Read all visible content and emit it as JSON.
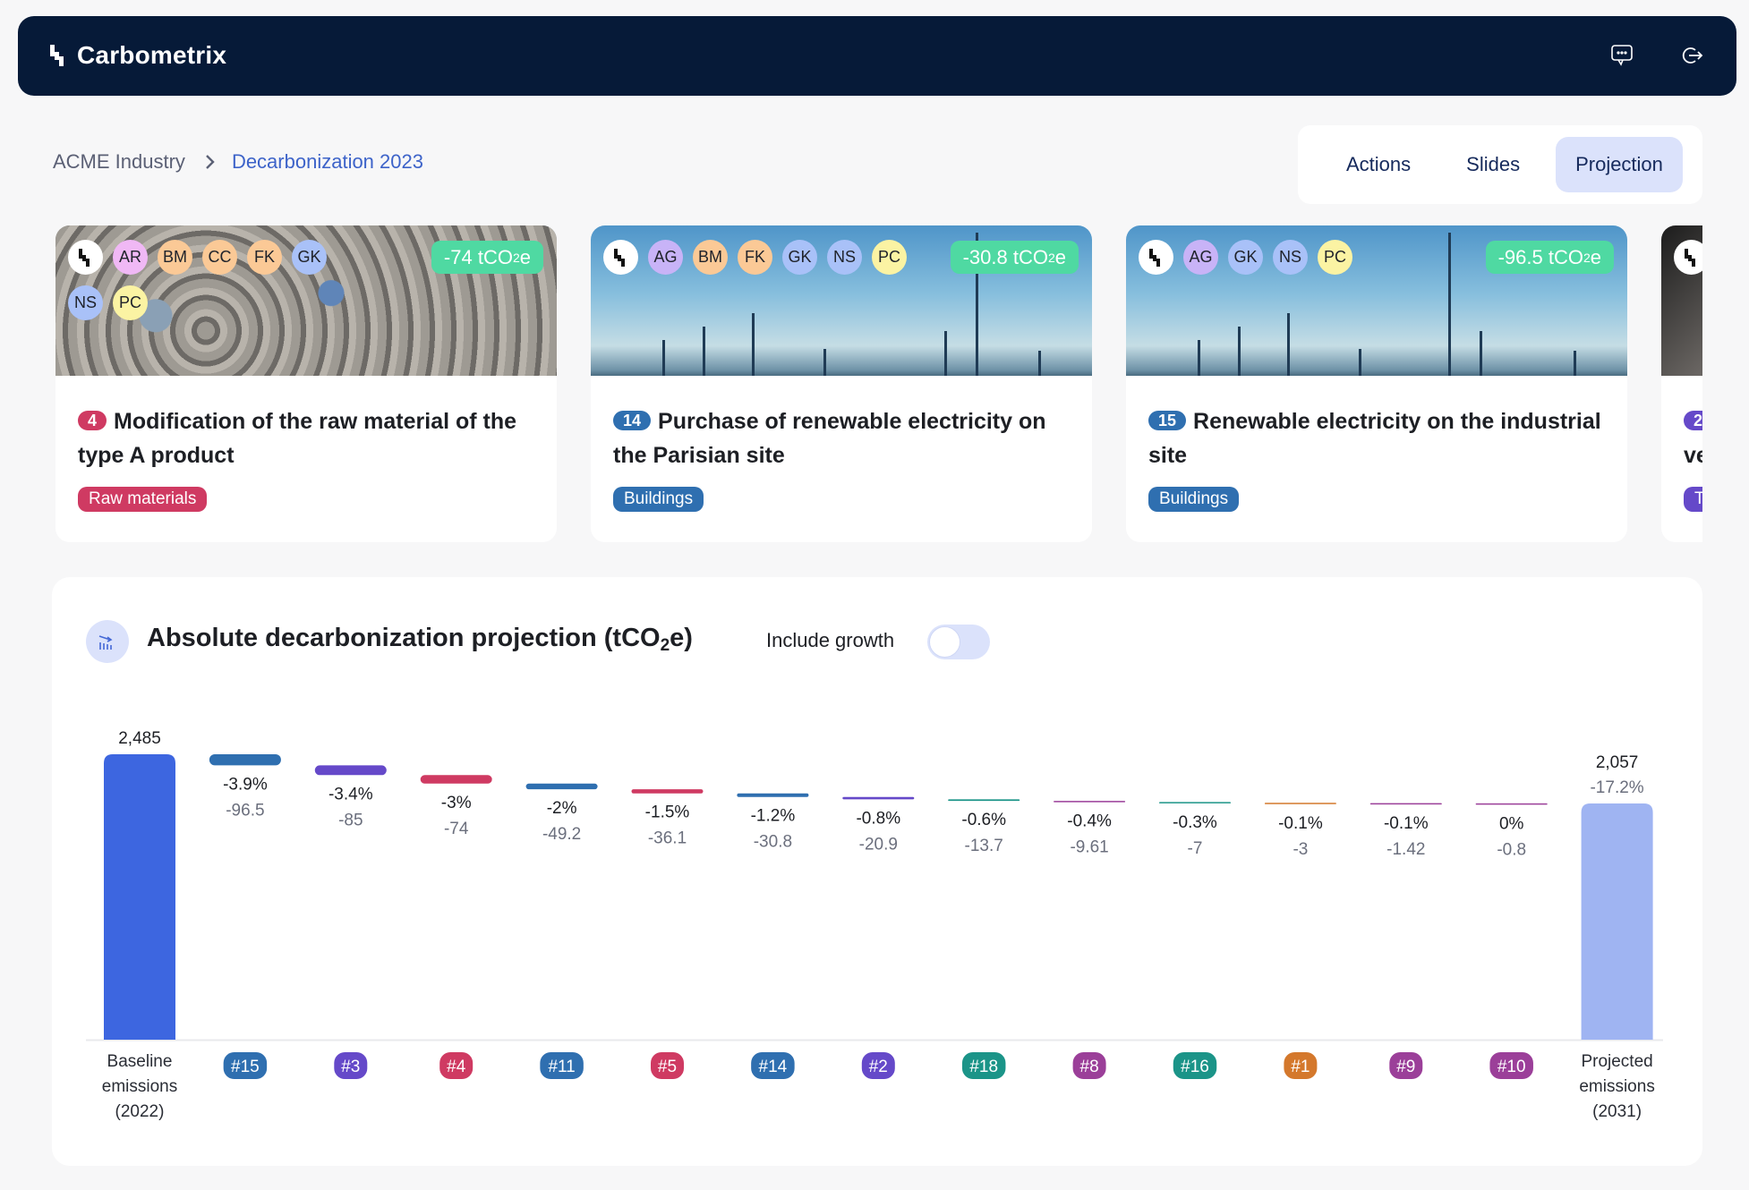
{
  "app": {
    "name": "Carbometrix",
    "icons": {
      "feedback": "chat-bubble-icon",
      "logout": "logout-icon"
    }
  },
  "breadcrumb": {
    "root": "ACME Industry",
    "current": "Decarbonization 2023"
  },
  "tabs": [
    {
      "label": "Actions",
      "active": false
    },
    {
      "label": "Slides",
      "active": false
    },
    {
      "label": "Projection",
      "active": true
    }
  ],
  "cards": [
    {
      "number": "4",
      "title": "Modification of the raw material of the type A product",
      "category": "Raw materials",
      "category_color": "#cf3a62",
      "number_color": "#cf3a62",
      "impact_value": "-74 tCO",
      "impact_sub": "2",
      "impact_unit": "e",
      "image": "steel-pipes",
      "avatars": [
        {
          "initials": "AR",
          "color": "#f0b8f5"
        },
        {
          "initials": "BM",
          "color": "#fbc996"
        },
        {
          "initials": "CC",
          "color": "#fbc996"
        },
        {
          "initials": "FK",
          "color": "#fbc996"
        },
        {
          "initials": "GK",
          "color": "#a9c1f8"
        },
        {
          "initials": "NS",
          "color": "#a9c1f8"
        },
        {
          "initials": "PC",
          "color": "#fbf3a3"
        }
      ]
    },
    {
      "number": "14",
      "title": "Purchase of renewable electricity on the Parisian site",
      "category": "Buildings",
      "category_color": "#2f6fb0",
      "number_color": "#2f6fb0",
      "impact_value": "-30.8 tCO",
      "impact_sub": "2",
      "impact_unit": "e",
      "image": "wind-turbines",
      "avatars": [
        {
          "initials": "AG",
          "color": "#c8b3f7"
        },
        {
          "initials": "BM",
          "color": "#fbc996"
        },
        {
          "initials": "FK",
          "color": "#fbc996"
        },
        {
          "initials": "GK",
          "color": "#a9c1f8"
        },
        {
          "initials": "NS",
          "color": "#a9c1f8"
        },
        {
          "initials": "PC",
          "color": "#fbf3a3"
        }
      ]
    },
    {
      "number": "15",
      "title": "Renewable electricity on the industrial site",
      "category": "Buildings",
      "category_color": "#2f6fb0",
      "number_color": "#2f6fb0",
      "impact_value": "-96.5 tCO",
      "impact_sub": "2",
      "impact_unit": "e",
      "image": "wind-turbines",
      "avatars": [
        {
          "initials": "AG",
          "color": "#c8b3f7"
        },
        {
          "initials": "GK",
          "color": "#a9c1f8"
        },
        {
          "initials": "NS",
          "color": "#a9c1f8"
        },
        {
          "initials": "PC",
          "color": "#fbf3a3"
        }
      ]
    },
    {
      "number": "2",
      "title": "ve",
      "category": "T",
      "category_color": "#6549c9",
      "number_color": "#6549c9",
      "image": "dark-photo",
      "partial": true
    }
  ],
  "panel": {
    "title_main": "Absolute decarbonization projection (tCO",
    "title_sub": "2",
    "title_end": "e)",
    "icon": "chart-decrease-icon",
    "growth_toggle_label": "Include growth",
    "growth_toggle_on": false
  },
  "chart_data": {
    "type": "bar",
    "subtype": "waterfall",
    "title": "Absolute decarbonization projection (tCO2e)",
    "xlabel": "",
    "ylabel": "tCO2e",
    "ylim": [
      0,
      2485
    ],
    "grid": false,
    "baseline": {
      "label_lines": [
        "Baseline",
        "emissions",
        "(2022)"
      ],
      "value": 2485,
      "value_label": "2,485",
      "color": "#3d66e0"
    },
    "projected": {
      "label_lines": [
        "Projected",
        "emissions",
        "(2031)"
      ],
      "value": 2057,
      "value_label": "2,057",
      "change_label": "-17.2%",
      "color": "#9fb4f2"
    },
    "steps": [
      {
        "action": "#15",
        "value": -96.5,
        "value_label": "-96.5",
        "pct_label": "-3.9%",
        "color": "#2f6fb0"
      },
      {
        "action": "#3",
        "value": -85,
        "value_label": "-85",
        "pct_label": "-3.4%",
        "color": "#6549c9"
      },
      {
        "action": "#4",
        "value": -74,
        "value_label": "-74",
        "pct_label": "-3%",
        "color": "#cf3a62"
      },
      {
        "action": "#11",
        "value": -49.2,
        "value_label": "-49.2",
        "pct_label": "-2%",
        "color": "#2f6fb0"
      },
      {
        "action": "#5",
        "value": -36.1,
        "value_label": "-36.1",
        "pct_label": "-1.5%",
        "color": "#cf3a62"
      },
      {
        "action": "#14",
        "value": -30.8,
        "value_label": "-30.8",
        "pct_label": "-1.2%",
        "color": "#2f6fb0"
      },
      {
        "action": "#2",
        "value": -20.9,
        "value_label": "-20.9",
        "pct_label": "-0.8%",
        "color": "#6549c9"
      },
      {
        "action": "#18",
        "value": -13.7,
        "value_label": "-13.7",
        "pct_label": "-0.6%",
        "color": "#1b9488"
      },
      {
        "action": "#8",
        "value": -9.61,
        "value_label": "-9.61",
        "pct_label": "-0.4%",
        "color": "#9b3f99"
      },
      {
        "action": "#16",
        "value": -7,
        "value_label": "-7",
        "pct_label": "-0.3%",
        "color": "#1b9488"
      },
      {
        "action": "#1",
        "value": -3,
        "value_label": "-3",
        "pct_label": "-0.1%",
        "color": "#d4782c"
      },
      {
        "action": "#9",
        "value": -1.42,
        "value_label": "-1.42",
        "pct_label": "-0.1%",
        "color": "#9b3f99"
      },
      {
        "action": "#10",
        "value": -0.8,
        "value_label": "-0.8",
        "pct_label": "0%",
        "color": "#9b3f99"
      }
    ]
  }
}
